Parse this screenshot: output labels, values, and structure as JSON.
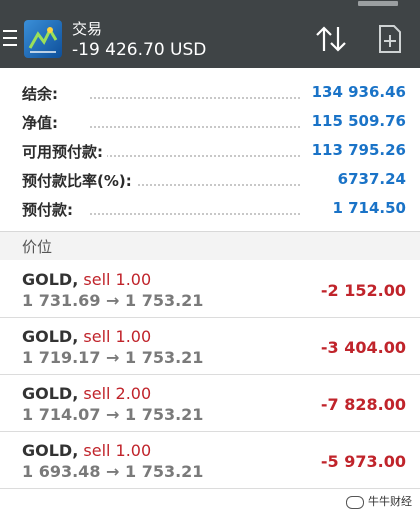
{
  "header": {
    "title": "交易",
    "balance_line": "-19 426.70 USD"
  },
  "summary": [
    {
      "label": "结余:",
      "value": "134 936.46"
    },
    {
      "label": "净值:",
      "value": "115 509.76"
    },
    {
      "label": "可用预付款:",
      "value": "113 795.26"
    },
    {
      "label": "预付款比率(%):",
      "value": "6737.24"
    },
    {
      "label": "预付款:",
      "value": "1 714.50"
    }
  ],
  "section_title": "价位",
  "trades": [
    {
      "symbol": "GOLD,",
      "side": " sell 1.00",
      "prices": "1 731.69 → 1 753.21",
      "profit": "-2 152.00"
    },
    {
      "symbol": "GOLD,",
      "side": " sell 1.00",
      "prices": "1 719.17 → 1 753.21",
      "profit": "-3 404.00"
    },
    {
      "symbol": "GOLD,",
      "side": " sell 2.00",
      "prices": "1 714.07 → 1 753.21",
      "profit": "-7 828.00"
    },
    {
      "symbol": "GOLD,",
      "side": " sell 1.00",
      "prices": "1 693.48 → 1 753.21",
      "profit": "-5 973.00"
    }
  ],
  "watermark": "牛牛财经",
  "colors": {
    "header_bg": "#3f4446",
    "value_blue": "#1a73c7",
    "loss_red": "#c0242b"
  },
  "icons": {
    "menu": "menu-icon",
    "sort": "sort-icon",
    "add": "add-order-icon",
    "logo": "app-logo"
  }
}
